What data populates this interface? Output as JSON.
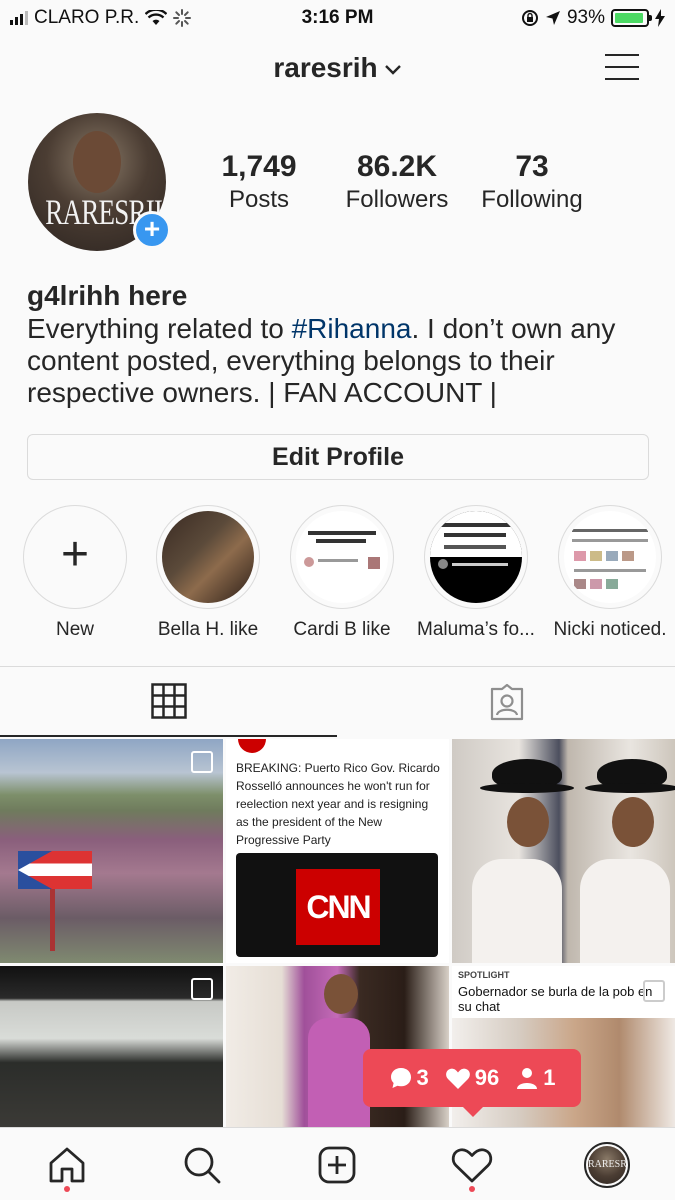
{
  "status_bar": {
    "carrier": "CLARO P.R.",
    "time": "3:16 PM",
    "battery": "93%"
  },
  "header": {
    "username": "raresrih"
  },
  "profile": {
    "avatar_text": "RARESRIH",
    "stats": [
      {
        "value": "1,749",
        "label": "Posts"
      },
      {
        "value": "86.2K",
        "label": "Followers"
      },
      {
        "value": "73",
        "label": "Following"
      }
    ],
    "display_name": "g4lrihh here",
    "bio_before": "Everything related to ",
    "bio_hashtag": "#Rihanna",
    "bio_after": ". I don’t own any content posted, everything belongs to their respective owners. | FAN ACCOUNT |",
    "edit_button": "Edit Profile"
  },
  "highlights": [
    {
      "label": "New"
    },
    {
      "label": "Bella H. like"
    },
    {
      "label": "Cardi B like"
    },
    {
      "label": "Maluma’s fo..."
    },
    {
      "label": "Nicki noticed."
    }
  ],
  "posts": {
    "news_text": "BREAKING: Puerto Rico Gov. Ricardo Rosselló announces he won't run for reelection next year and is resigning as the president of the New Progressive Party",
    "news_brand": "CNN",
    "spotlight_tag": "SPOTLIGHT",
    "spotlight_headline": "Gobernador se burla de la pob en su chat"
  },
  "activity": {
    "comments": "3",
    "likes": "96",
    "follows": "1"
  },
  "colors": {
    "accent_blue": "#3897f0",
    "notification_red": "#ed4956",
    "hashtag": "#003569"
  }
}
